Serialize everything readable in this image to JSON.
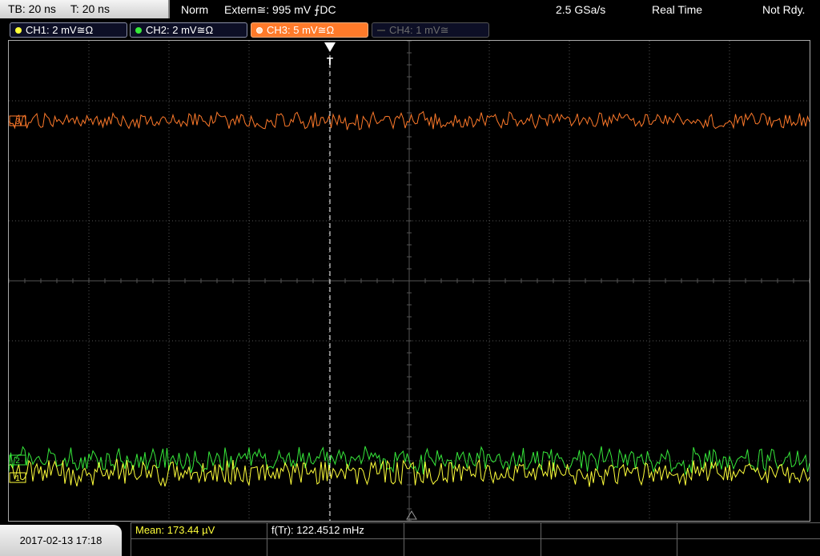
{
  "status": {
    "timebase": "TB: 20 ns",
    "trigger_time": "T: 20 ns",
    "mode": "Norm",
    "trigger_source": "Extern≅: 995 mV ⨍DC",
    "sample_rate": "2.5 GSa/s",
    "acquisition": "Real Time",
    "state": "Not Rdy."
  },
  "channels": [
    {
      "label": "CH1: 2 mV≅Ω",
      "color": "#ffff3a",
      "state": "on"
    },
    {
      "label": "CH2: 2 mV≅Ω",
      "color": "#36e83a",
      "state": "on"
    },
    {
      "label": "CH3: 5 mV≅Ω",
      "color": "#ff7a2a",
      "state": "active"
    },
    {
      "label": "CH4: 1 mV≅",
      "color": "#555555",
      "state": "off"
    }
  ],
  "markers": {
    "trigger": "T",
    "ch3": "3",
    "ch2": "2",
    "ch1": "1"
  },
  "measurements": {
    "mean": "Mean: 173.44 µV",
    "frequency": "f(Tr): 122.4512 mHz"
  },
  "datetime": "2017-02-13 17:18",
  "colors": {
    "ch1": "#ffff3a",
    "ch2": "#36e83a",
    "ch3": "#ff7a2a",
    "grid": "#555555",
    "measurement_mean": "#ffff3a"
  }
}
